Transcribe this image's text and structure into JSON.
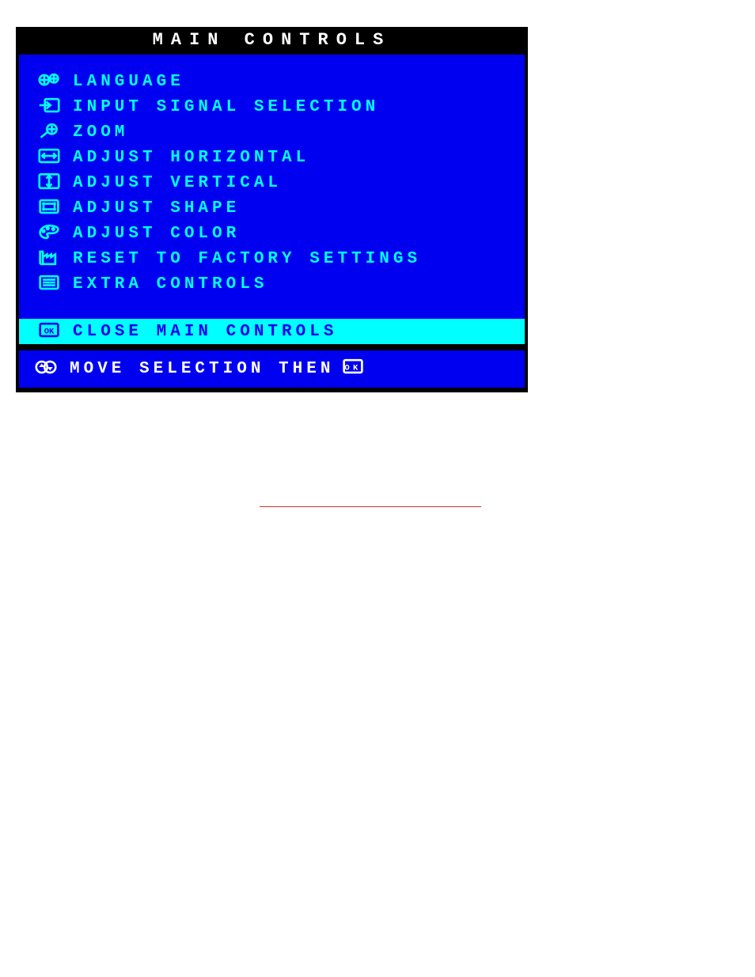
{
  "osd": {
    "title": "MAIN CONTROLS",
    "items": [
      {
        "icon": "language",
        "label": "LANGUAGE"
      },
      {
        "icon": "input",
        "label": "INPUT SIGNAL SELECTION"
      },
      {
        "icon": "zoom",
        "label": "ZOOM"
      },
      {
        "icon": "adj-h",
        "label": "ADJUST HORIZONTAL"
      },
      {
        "icon": "adj-v",
        "label": "ADJUST VERTICAL"
      },
      {
        "icon": "shape",
        "label": "ADJUST SHAPE"
      },
      {
        "icon": "color",
        "label": "ADJUST COLOR"
      },
      {
        "icon": "factory",
        "label": "RESET TO FACTORY SETTINGS"
      },
      {
        "icon": "extra",
        "label": "EXTRA CONTROLS"
      }
    ],
    "close": {
      "icon": "ok",
      "label": "CLOSE MAIN CONTROLS"
    },
    "hint": {
      "icon": "updown",
      "text": "MOVE SELECTION THEN",
      "trailing_icon": "ok"
    }
  },
  "links": {
    "return_label": ""
  }
}
